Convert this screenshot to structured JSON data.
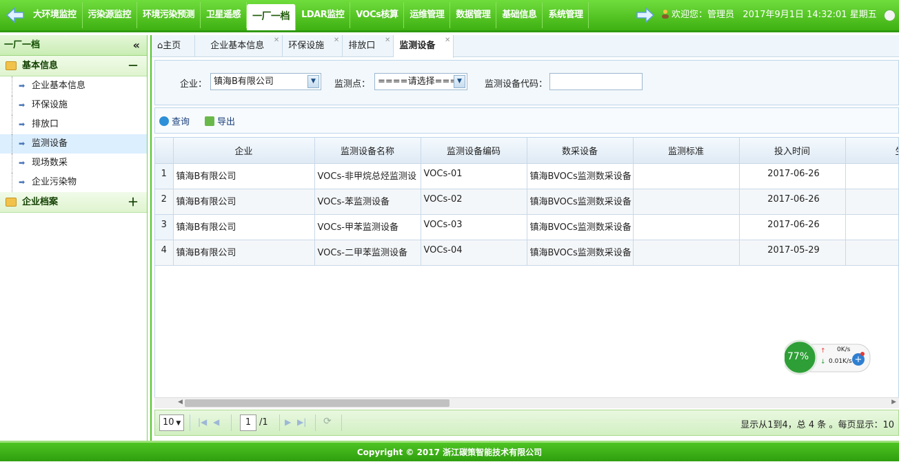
{
  "topnav": {
    "items": [
      "大环境监控",
      "污染源监控",
      "环境污染预测",
      "卫星遥感",
      "一厂一档",
      "LDAR监控",
      "VOCs核算",
      "运维管理",
      "数据管理",
      "基础信息",
      "系统管理"
    ],
    "active": "一厂一档",
    "welcome": "欢迎您：管理员",
    "datetime": "2017年9月1日 14:32:01 星期五"
  },
  "sidebar": {
    "title": "一厂一档",
    "groups": [
      {
        "label": "基本信息",
        "toggle": "－",
        "items": [
          "企业基本信息",
          "环保设施",
          "排放口",
          "监测设备",
          "现场数采",
          "企业污染物"
        ]
      },
      {
        "label": "企业档案",
        "toggle": "＋"
      }
    ]
  },
  "tabs": [
    "主页",
    "企业基本信息",
    "环保设施",
    "排放口",
    "监测设备"
  ],
  "filter": {
    "enterprise_label": "企业：",
    "enterprise_value": "镇海B有限公司",
    "point_label": "监测点：",
    "point_value": "====请选择===",
    "code_label": "监测设备代码：",
    "code_value": ""
  },
  "toolbar": {
    "query": "查询",
    "export": "导出"
  },
  "table": {
    "headers": [
      "企业",
      "监测设备名称",
      "监测设备编码",
      "数采设备",
      "监测标准",
      "投入时间",
      "生产"
    ],
    "rows": [
      [
        "1",
        "镇海B有限公司",
        "VOCs-非甲烷总烃监测设",
        "VOCs-01",
        "镇海BVOCs监测数采设备",
        "",
        "2017-06-26",
        ""
      ],
      [
        "2",
        "镇海B有限公司",
        "VOCs-苯监测设备",
        "VOCs-02",
        "镇海BVOCs监测数采设备",
        "",
        "2017-06-26",
        ""
      ],
      [
        "3",
        "镇海B有限公司",
        "VOCs-甲苯监测设备",
        "VOCs-03",
        "镇海BVOCs监测数采设备",
        "",
        "2017-06-26",
        ""
      ],
      [
        "4",
        "镇海B有限公司",
        "VOCs-二甲苯监测设备",
        "VOCs-04",
        "镇海BVOCs监测数采设备",
        "",
        "2017-05-29",
        ""
      ]
    ]
  },
  "pager": {
    "page_size": "10",
    "current_page": "1",
    "total_pages": "/1",
    "info": "显示从1到4，总 4 条 。每页显示：10"
  },
  "widget": {
    "percent": "77%",
    "up": "0K/s",
    "down": "0.01K/s"
  },
  "footer": "Copyright © 2017 浙江碳策智能技术有限公司",
  "colors": {
    "nav_green": "#3fb112",
    "accent_blue": "#1b3f7a"
  }
}
